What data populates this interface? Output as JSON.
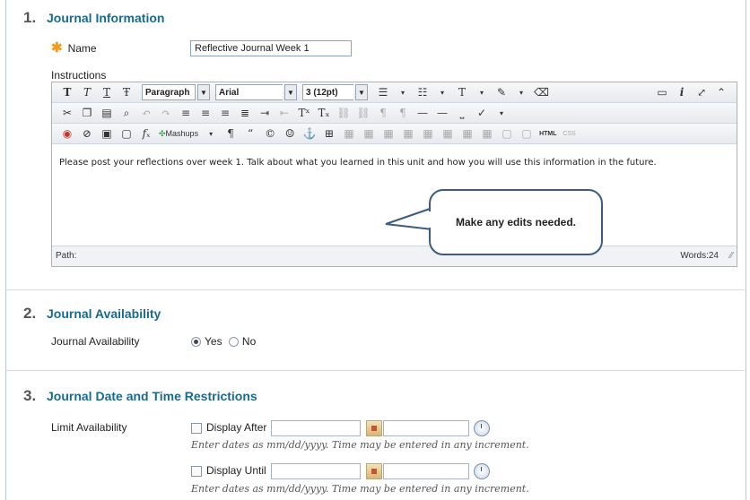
{
  "sections": [
    {
      "number": "1.",
      "title": "Journal Information"
    },
    {
      "number": "2.",
      "title": "Journal Availability"
    },
    {
      "number": "3.",
      "title": "Journal Date and Time Restrictions"
    }
  ],
  "journal_info": {
    "required_mark": "✱",
    "name_label": "Name",
    "name_value": "Reflective Journal Week 1",
    "instructions_label": "Instructions"
  },
  "editor": {
    "row1": {
      "text_buttons": [
        "T",
        "T",
        "T",
        "Ŧ"
      ],
      "format_select": "Paragraph",
      "font_select": "Arial",
      "size_select": "3 (12pt)"
    },
    "content": "Please post your reflections over week 1.  Talk about what you learned in this unit and how you will use this information in the future.",
    "path_label": "Path:",
    "word_count": "Words:24",
    "mashups_label": "Mashups",
    "html_label": "HTML",
    "css_label": "CSS"
  },
  "callout": {
    "text": "Make any edits needed."
  },
  "availability": {
    "label": "Journal Availability",
    "yes_label": "Yes",
    "no_label": "No",
    "selected": "Yes"
  },
  "restrictions": {
    "label": "Limit Availability",
    "display_after_label": "Display After",
    "display_until_label": "Display Until",
    "hint": "Enter dates as mm/dd/yyyy. Time may be entered in any increment."
  },
  "colors": {
    "accent": "#1a6a8a",
    "required": "#f29b1d",
    "callout_border": "#3d5a80"
  }
}
